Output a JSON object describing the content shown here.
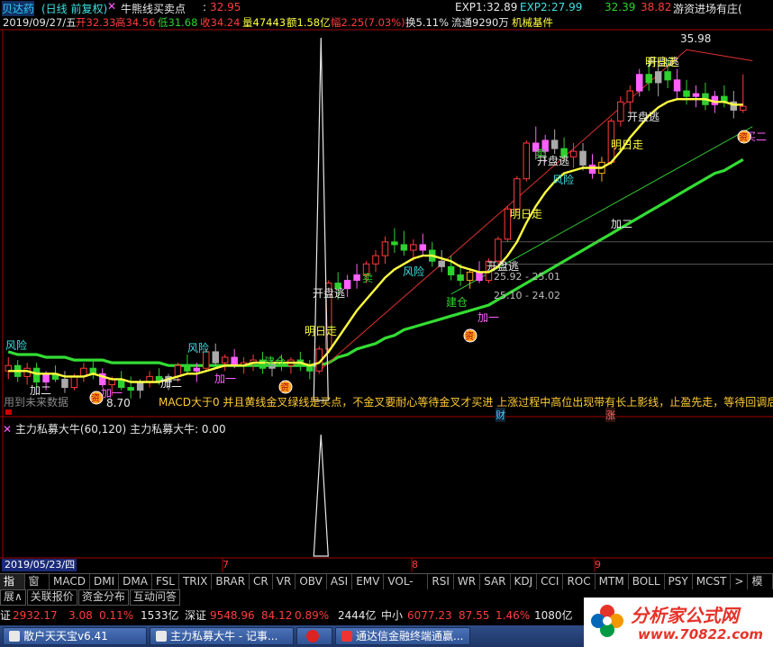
{
  "header": {
    "code_name": "贝达药",
    "period": "(日线 前复权)",
    "formula": "牛熊线买卖点",
    "price_sep": ":",
    "price": "32.95",
    "exp1_label": "EXP1:",
    "exp1": "32.89",
    "exp2_label": "EXP2:",
    "exp2": "27.99",
    "extra1": "32.39",
    "extra2": "38.82",
    "right_label": "游资进场有庄("
  },
  "quote": {
    "date": "2019/09/27/五",
    "open": "开32.33",
    "high": "高34.56",
    "low": "低31.68",
    "close": "收34.24",
    "vol": "量47443",
    "amount": "额1.58亿",
    "change": "幅2.25(7.03%)",
    "turnover": "换5.11%",
    "float": "流通9290万",
    "industry": "机械基件"
  },
  "chart_data": {
    "type": "candlestick",
    "candles": [
      [
        24.6,
        25.1,
        24.3,
        24.8
      ],
      [
        24.8,
        25.0,
        24.2,
        24.4
      ],
      [
        24.4,
        24.9,
        24.1,
        24.7
      ],
      [
        24.7,
        24.9,
        24.0,
        24.2
      ],
      [
        24.2,
        24.6,
        23.9,
        24.5
      ],
      [
        24.5,
        24.8,
        24.2,
        24.3
      ],
      [
        24.3,
        24.6,
        23.8,
        24.0
      ],
      [
        24.0,
        24.5,
        23.9,
        24.4
      ],
      [
        24.4,
        24.9,
        24.2,
        24.7
      ],
      [
        24.7,
        25.0,
        24.3,
        24.5
      ],
      [
        24.5,
        24.7,
        24.0,
        24.1
      ],
      [
        24.1,
        24.4,
        23.7,
        24.3
      ],
      [
        24.3,
        24.6,
        23.9,
        24.0
      ],
      [
        24.0,
        24.4,
        23.6,
        23.9
      ],
      [
        23.9,
        24.3,
        23.6,
        24.2
      ],
      [
        24.2,
        24.6,
        24.0,
        24.4
      ],
      [
        24.4,
        24.7,
        24.1,
        24.2
      ],
      [
        24.2,
        24.5,
        23.9,
        24.4
      ],
      [
        24.4,
        24.9,
        24.2,
        24.8
      ],
      [
        24.8,
        25.2,
        24.5,
        24.6
      ],
      [
        24.6,
        24.9,
        24.2,
        24.7
      ],
      [
        24.7,
        25.4,
        24.6,
        25.3
      ],
      [
        25.3,
        25.6,
        24.8,
        24.9
      ],
      [
        24.9,
        25.2,
        24.6,
        25.1
      ],
      [
        25.1,
        25.4,
        24.7,
        24.8
      ],
      [
        24.8,
        25.1,
        24.5,
        24.9
      ],
      [
        24.9,
        25.2,
        24.6,
        25.0
      ],
      [
        25.0,
        25.3,
        24.5,
        24.7
      ],
      [
        24.7,
        25.0,
        24.4,
        24.9
      ],
      [
        24.9,
        25.2,
        24.6,
        24.8
      ],
      [
        24.8,
        25.1,
        24.5,
        25.0
      ],
      [
        25.0,
        25.3,
        24.6,
        24.8
      ],
      [
        24.8,
        25.0,
        24.3,
        24.6
      ],
      [
        24.6,
        25.5,
        24.5,
        25.4
      ],
      [
        25.4,
        27.9,
        25.3,
        27.8
      ],
      [
        27.8,
        28.2,
        27.2,
        27.6
      ],
      [
        27.6,
        28.1,
        27.3,
        27.9
      ],
      [
        27.9,
        28.5,
        27.6,
        28.1
      ],
      [
        28.1,
        28.6,
        27.8,
        28.5
      ],
      [
        28.5,
        29.0,
        28.2,
        28.8
      ],
      [
        28.8,
        29.5,
        28.5,
        29.3
      ],
      [
        29.3,
        29.8,
        28.9,
        29.2
      ],
      [
        29.2,
        29.7,
        28.8,
        29.0
      ],
      [
        29.0,
        29.4,
        28.6,
        29.2
      ],
      [
        29.2,
        29.6,
        28.8,
        29.0
      ],
      [
        29.0,
        29.3,
        28.4,
        28.6
      ],
      [
        28.6,
        29.0,
        28.2,
        28.4
      ],
      [
        28.4,
        28.8,
        27.9,
        28.1
      ],
      [
        28.1,
        28.5,
        27.7,
        27.9
      ],
      [
        27.9,
        28.3,
        27.6,
        28.2
      ],
      [
        28.2,
        28.6,
        27.8,
        27.9
      ],
      [
        27.9,
        28.7,
        27.8,
        28.6
      ],
      [
        28.6,
        29.5,
        28.5,
        29.4
      ],
      [
        29.4,
        30.6,
        29.3,
        30.5
      ],
      [
        30.5,
        31.7,
        30.4,
        31.6
      ],
      [
        31.6,
        33.0,
        31.5,
        32.9
      ],
      [
        32.9,
        33.5,
        32.3,
        32.6
      ],
      [
        32.6,
        33.2,
        32.2,
        33.0
      ],
      [
        33.0,
        33.4,
        32.5,
        32.7
      ],
      [
        32.7,
        33.1,
        32.2,
        32.4
      ],
      [
        32.4,
        32.9,
        32.0,
        32.6
      ],
      [
        32.6,
        32.9,
        31.9,
        32.1
      ],
      [
        32.1,
        32.5,
        31.6,
        31.8
      ],
      [
        31.8,
        32.4,
        31.5,
        32.2
      ],
      [
        32.2,
        33.8,
        32.1,
        33.7
      ],
      [
        33.7,
        34.6,
        33.5,
        34.4
      ],
      [
        34.4,
        35.0,
        34.0,
        34.8
      ],
      [
        34.8,
        35.6,
        34.6,
        35.4
      ],
      [
        35.4,
        35.9,
        34.8,
        35.1
      ],
      [
        35.1,
        35.7,
        34.6,
        35.5
      ],
      [
        35.5,
        35.98,
        34.9,
        35.2
      ],
      [
        35.2,
        35.6,
        34.5,
        34.8
      ],
      [
        34.8,
        35.2,
        34.3,
        34.6
      ],
      [
        34.6,
        35.0,
        34.2,
        34.7
      ],
      [
        34.7,
        35.1,
        34.1,
        34.3
      ],
      [
        34.3,
        34.8,
        34.0,
        34.6
      ],
      [
        34.6,
        35.0,
        34.2,
        34.4
      ],
      [
        34.4,
        34.8,
        33.8,
        34.1
      ],
      [
        34.1,
        35.4,
        34.0,
        34.24
      ]
    ],
    "ma_yellow": [
      24.6,
      24.6,
      24.6,
      24.5,
      24.5,
      24.5,
      24.4,
      24.4,
      24.4,
      24.5,
      24.4,
      24.3,
      24.3,
      24.2,
      24.2,
      24.2,
      24.2,
      24.3,
      24.4,
      24.5,
      24.5,
      24.6,
      24.7,
      24.8,
      24.8,
      24.8,
      24.9,
      24.9,
      24.9,
      24.9,
      24.9,
      24.9,
      24.8,
      24.9,
      25.3,
      25.8,
      26.3,
      26.8,
      27.2,
      27.6,
      28.0,
      28.3,
      28.5,
      28.7,
      28.8,
      28.8,
      28.7,
      28.6,
      28.4,
      28.3,
      28.2,
      28.2,
      28.4,
      28.8,
      29.3,
      30.0,
      30.6,
      31.1,
      31.5,
      31.8,
      31.9,
      32.0,
      32.0,
      32.0,
      32.2,
      32.6,
      33.1,
      33.5,
      33.9,
      34.2,
      34.4,
      34.5,
      34.5,
      34.5,
      34.5,
      34.4,
      34.4,
      34.3,
      34.3
    ],
    "ma_green": [
      25.3,
      25.2,
      25.2,
      25.2,
      25.1,
      25.1,
      25.1,
      25.0,
      25.0,
      25.0,
      25.0,
      24.9,
      24.9,
      24.9,
      24.9,
      24.9,
      24.9,
      24.8,
      24.8,
      24.8,
      24.8,
      24.8,
      24.8,
      24.8,
      24.8,
      24.8,
      24.8,
      24.8,
      24.8,
      24.8,
      24.8,
      24.8,
      24.8,
      24.8,
      24.9,
      25.1,
      25.2,
      25.4,
      25.5,
      25.6,
      25.8,
      25.9,
      26.1,
      26.2,
      26.3,
      26.4,
      26.5,
      26.6,
      26.7,
      26.8,
      26.9,
      27.0,
      27.2,
      27.4,
      27.6,
      27.8,
      28.0,
      28.2,
      28.4,
      28.6,
      28.8,
      29.0,
      29.2,
      29.4,
      29.6,
      29.8,
      30.0,
      30.2,
      30.4,
      30.6,
      30.8,
      31.0,
      31.2,
      31.4,
      31.6,
      31.8,
      31.9,
      32.1,
      32.3
    ],
    "price_levels": [
      "35.98",
      "8.70",
      "25.01",
      "24.02"
    ],
    "indicator_name": "主力私募大牛(60,120)",
    "indicator_value_label": "主力私募大牛: 0.00"
  },
  "signals": {
    "risk": "风险",
    "add_two": "加二",
    "add_one": "加一",
    "buy_two": "买二",
    "sell": "卖",
    "open_escape": "开盘逃",
    "tomorrow_go": "明日走",
    "build_pos": "建仓",
    "money_bag": "资"
  },
  "note_text": "MACD大于0 并且黄线金叉绿线是买点，不金叉要耐心等待金叉才买进 上涨过程中高位出现带有长上影线，止盈先走，等待回调后",
  "future_data": "用到未来数据",
  "level_25": "25.92 - 25.01",
  "level_24": "25.10 - 24.02",
  "axis": {
    "date_label": "2019/05/23/四",
    "months": [
      "7",
      "8",
      "9"
    ],
    "event_cai": "财",
    "event_zhang": "涨"
  },
  "tabs": [
    "指标",
    "窗口",
    "MACD",
    "DMI",
    "DMA",
    "FSL",
    "TRIX",
    "BRAR",
    "CR",
    "VR",
    "OBV",
    "ASI",
    "EMV",
    "VOL-TDX",
    "RSI",
    "WR",
    "SAR",
    "KDJ",
    "CCI",
    "ROC",
    "MTM",
    "BOLL",
    "PSY",
    "MCST",
    ">",
    "模板"
  ],
  "subtabs": [
    "展∧",
    "关联报价",
    "资金分布",
    "互动问答"
  ],
  "status": {
    "sh_label": "证",
    "sh_index": "2932.17",
    "sh_chg": "3.08",
    "sh_pct": "0.11%",
    "sh_amt": "1533亿",
    "sz_label": "深证",
    "sz_index": "9548.96",
    "sz_chg": "84.12",
    "sz_pct": "0.89%",
    "sz_amt": "2444亿",
    "zx_label": "中小",
    "zx_index": "6077.23",
    "zx_chg": "87.55",
    "zx_pct": "1.46%",
    "zx_amt": "1080亿"
  },
  "taskbar": [
    "散户天天宝v6.41",
    "主力私募大牛 - 记事...",
    "",
    "通达信金融终端通赢..."
  ],
  "brand": {
    "name": "分析家公式网",
    "url": "www.70822.com"
  },
  "colors": {
    "up": "#ff3c3c",
    "down": "#2fd12f",
    "ma_yellow": "#ffff40",
    "ma_green": "#33dd33",
    "bg": "#000000"
  }
}
